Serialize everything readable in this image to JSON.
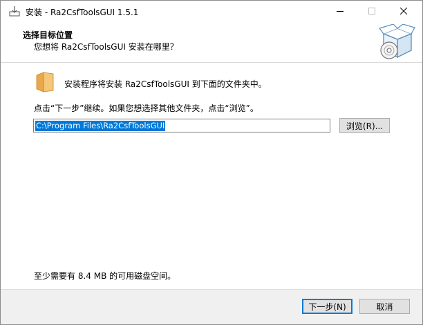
{
  "window": {
    "title": "安装 - Ra2CsfToolsGUI 1.5.1",
    "controls": {
      "minimize": "minimize",
      "maximize": "maximize",
      "close": "close"
    }
  },
  "header": {
    "title": "选择目标位置",
    "subtitle": "您想将 Ra2CsfToolsGUI 安装在哪里？"
  },
  "content": {
    "intro": "安装程序将安装 Ra2CsfToolsGUI 到下面的文件夹中。",
    "instruction": "点击“下一步”继续。如果您想选择其他文件夹，点击“浏览”。",
    "path_value": "C:\\Program Files\\Ra2CsfToolsGUI",
    "browse_label": "浏览(R)...",
    "space_required": "至少需要有 8.4 MB 的可用磁盘空间。"
  },
  "footer": {
    "next_label": "下一步(N)",
    "cancel_label": "取消"
  },
  "colors": {
    "accent": "#0078d7",
    "footer_bg": "#f0f0f0",
    "button_bg": "#e1e1e1",
    "folder": "#f5c77a"
  }
}
